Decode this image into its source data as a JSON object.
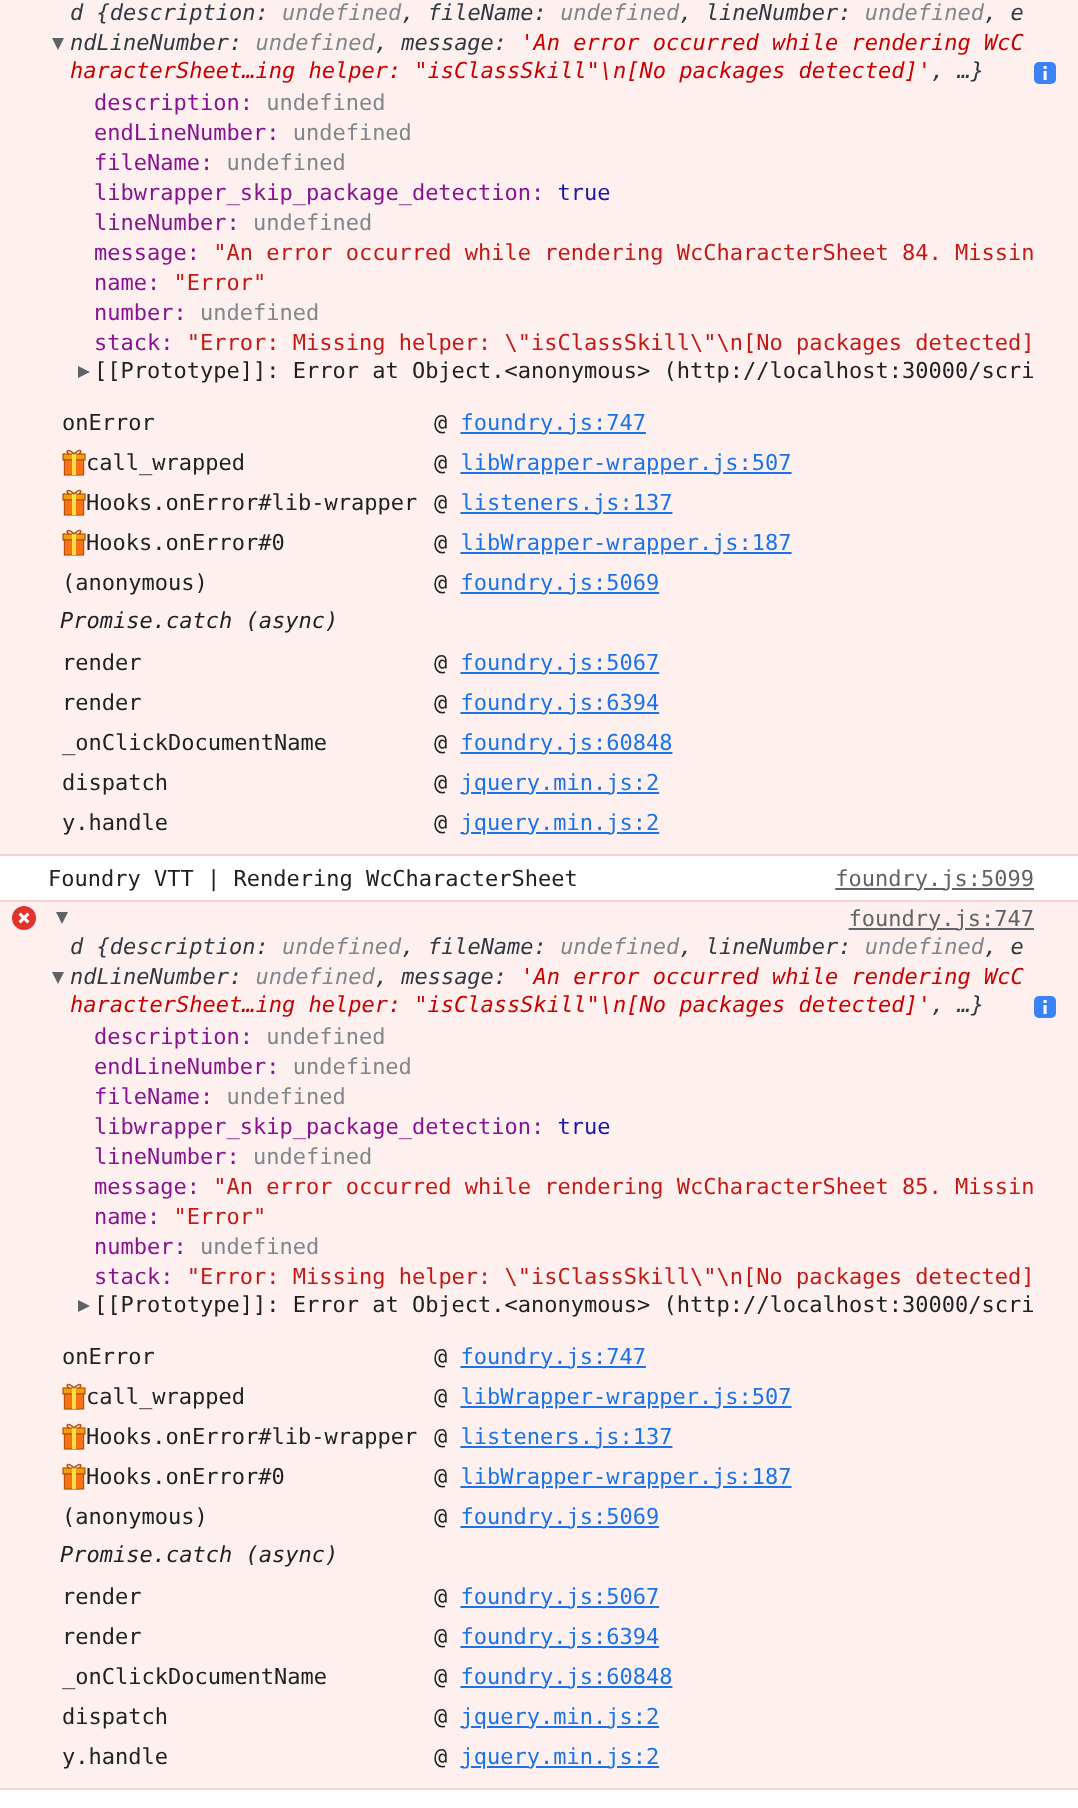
{
  "console": [
    {
      "kind": "error",
      "object": {
        "expanded": true,
        "preview": [
          {
            "kind": "plain",
            "s": "d {description: "
          },
          {
            "kind": "undefined",
            "s": "undefined"
          },
          {
            "kind": "plain",
            "s": ", fileName: "
          },
          {
            "kind": "undefined",
            "s": "undefined"
          },
          {
            "kind": "plain",
            "s": ", lineNumber: "
          },
          {
            "kind": "undefined",
            "s": "undefined"
          },
          {
            "kind": "plain",
            "s": ", endLineNumber: "
          },
          {
            "kind": "undefined",
            "s": "undefined"
          },
          {
            "kind": "plain",
            "s": ", message: "
          },
          {
            "kind": "string",
            "s": "'An error occurred while rendering WcCharacterSheet…ing helper: \"isClassSkill\"\\n[No packages detected]'"
          },
          {
            "kind": "plain",
            "s": ", …}"
          }
        ],
        "properties": [
          {
            "key": "description:",
            "value": "undefined",
            "kind": "undefined"
          },
          {
            "key": "endLineNumber:",
            "value": "undefined",
            "kind": "undefined"
          },
          {
            "key": "fileName:",
            "value": "undefined",
            "kind": "undefined"
          },
          {
            "key": "libwrapper_skip_package_detection:",
            "value": "true",
            "kind": "boolean"
          },
          {
            "key": "lineNumber:",
            "value": "undefined",
            "kind": "undefined"
          },
          {
            "key": "message:",
            "value": "\"An error occurred while rendering WcCharacterSheet 84. Missin",
            "kind": "string"
          },
          {
            "key": "name:",
            "value": "\"Error\"",
            "kind": "string"
          },
          {
            "key": "number:",
            "value": "undefined",
            "kind": "undefined"
          },
          {
            "key": "stack:",
            "value": "\"Error: Missing helper: \\\"isClassSkill\\\"\\n[No packages detected]",
            "kind": "string"
          }
        ],
        "prototype": {
          "expanded": false,
          "text": "[[Prototype]]: Error at Object.<anonymous> (http://localhost:30000/scri"
        }
      },
      "stack": [
        {
          "kind": "frame",
          "function": "onError",
          "wrapped": false,
          "at": "@",
          "location": "foundry.js:747"
        },
        {
          "kind": "frame",
          "function": "call_wrapped",
          "wrapped": true,
          "at": "@",
          "location": "libWrapper-wrapper.js:507"
        },
        {
          "kind": "frame",
          "function": "Hooks.onError#lib-wrapper",
          "wrapped": true,
          "at": "@",
          "location": "listeners.js:137"
        },
        {
          "kind": "frame",
          "function": "Hooks.onError#0",
          "wrapped": true,
          "at": "@",
          "location": "libWrapper-wrapper.js:187"
        },
        {
          "kind": "frame",
          "function": "(anonymous)",
          "wrapped": false,
          "at": "@",
          "location": "foundry.js:5069"
        },
        {
          "kind": "async",
          "text": "Promise.catch (async)"
        },
        {
          "kind": "frame",
          "function": "render",
          "wrapped": false,
          "at": "@",
          "location": "foundry.js:5067"
        },
        {
          "kind": "frame",
          "function": "render",
          "wrapped": false,
          "at": "@",
          "location": "foundry.js:6394"
        },
        {
          "kind": "frame",
          "function": "_onClickDocumentName",
          "wrapped": false,
          "at": "@",
          "location": "foundry.js:60848"
        },
        {
          "kind": "frame",
          "function": "dispatch",
          "wrapped": false,
          "at": "@",
          "location": "jquery.min.js:2"
        },
        {
          "kind": "frame",
          "function": "y.handle",
          "wrapped": false,
          "at": "@",
          "location": "jquery.min.js:2"
        }
      ]
    },
    {
      "kind": "log",
      "text": "Foundry VTT | Rendering WcCharacterSheet",
      "source": "foundry.js:5099"
    },
    {
      "kind": "error",
      "expanded": true,
      "source": "foundry.js:747",
      "object": {
        "expanded": true,
        "preview": [
          {
            "kind": "plain",
            "s": "d {description: "
          },
          {
            "kind": "undefined",
            "s": "undefined"
          },
          {
            "kind": "plain",
            "s": ", fileName: "
          },
          {
            "kind": "undefined",
            "s": "undefined"
          },
          {
            "kind": "plain",
            "s": ", lineNumber: "
          },
          {
            "kind": "undefined",
            "s": "undefined"
          },
          {
            "kind": "plain",
            "s": ", endLineNumber: "
          },
          {
            "kind": "undefined",
            "s": "undefined"
          },
          {
            "kind": "plain",
            "s": ", message: "
          },
          {
            "kind": "string",
            "s": "'An error occurred while rendering WcCharacterSheet…ing helper: \"isClassSkill\"\\n[No packages detected]'"
          },
          {
            "kind": "plain",
            "s": ", …}"
          }
        ],
        "properties": [
          {
            "key": "description:",
            "value": "undefined",
            "kind": "undefined"
          },
          {
            "key": "endLineNumber:",
            "value": "undefined",
            "kind": "undefined"
          },
          {
            "key": "fileName:",
            "value": "undefined",
            "kind": "undefined"
          },
          {
            "key": "libwrapper_skip_package_detection:",
            "value": "true",
            "kind": "boolean"
          },
          {
            "key": "lineNumber:",
            "value": "undefined",
            "kind": "undefined"
          },
          {
            "key": "message:",
            "value": "\"An error occurred while rendering WcCharacterSheet 85. Missin",
            "kind": "string"
          },
          {
            "key": "name:",
            "value": "\"Error\"",
            "kind": "string"
          },
          {
            "key": "number:",
            "value": "undefined",
            "kind": "undefined"
          },
          {
            "key": "stack:",
            "value": "\"Error: Missing helper: \\\"isClassSkill\\\"\\n[No packages detected]",
            "kind": "string"
          }
        ],
        "prototype": {
          "expanded": false,
          "text": "[[Prototype]]: Error at Object.<anonymous> (http://localhost:30000/scri"
        }
      },
      "stack": [
        {
          "kind": "frame",
          "function": "onError",
          "wrapped": false,
          "at": "@",
          "location": "foundry.js:747"
        },
        {
          "kind": "frame",
          "function": "call_wrapped",
          "wrapped": true,
          "at": "@",
          "location": "libWrapper-wrapper.js:507"
        },
        {
          "kind": "frame",
          "function": "Hooks.onError#lib-wrapper",
          "wrapped": true,
          "at": "@",
          "location": "listeners.js:137"
        },
        {
          "kind": "frame",
          "function": "Hooks.onError#0",
          "wrapped": true,
          "at": "@",
          "location": "libWrapper-wrapper.js:187"
        },
        {
          "kind": "frame",
          "function": "(anonymous)",
          "wrapped": false,
          "at": "@",
          "location": "foundry.js:5069"
        },
        {
          "kind": "async",
          "text": "Promise.catch (async)"
        },
        {
          "kind": "frame",
          "function": "render",
          "wrapped": false,
          "at": "@",
          "location": "foundry.js:5067"
        },
        {
          "kind": "frame",
          "function": "render",
          "wrapped": false,
          "at": "@",
          "location": "foundry.js:6394"
        },
        {
          "kind": "frame",
          "function": "_onClickDocumentName",
          "wrapped": false,
          "at": "@",
          "location": "foundry.js:60848"
        },
        {
          "kind": "frame",
          "function": "dispatch",
          "wrapped": false,
          "at": "@",
          "location": "jquery.min.js:2"
        },
        {
          "kind": "frame",
          "function": "y.handle",
          "wrapped": false,
          "at": "@",
          "location": "jquery.min.js:2"
        }
      ]
    }
  ]
}
